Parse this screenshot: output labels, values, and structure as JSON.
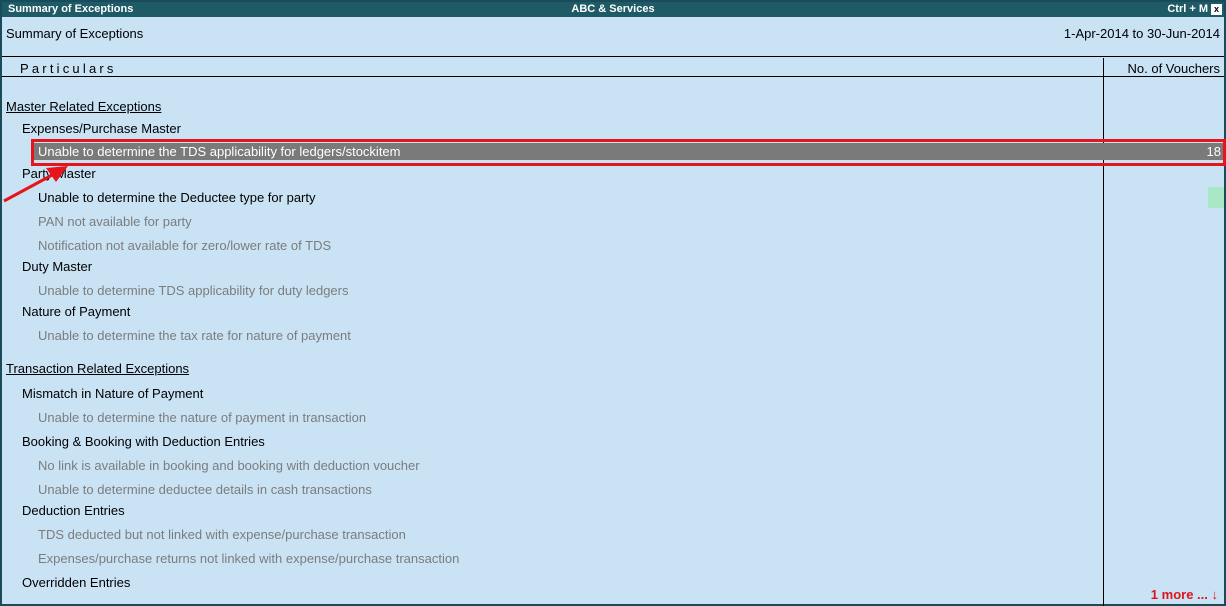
{
  "titlebar": {
    "left": "Summary of Exceptions",
    "center": "ABC & Services",
    "shortcut": "Ctrl + M",
    "close": "x"
  },
  "header": {
    "title": "Summary of Exceptions",
    "period": "1-Apr-2014 to 30-Jun-2014"
  },
  "columns": {
    "particulars": "Particulars",
    "vouchers": "No. of Vouchers"
  },
  "master": {
    "title": "Master Related Exceptions",
    "expenses_group": "Expenses/Purchase Master",
    "expenses_item": "Unable to determine the TDS applicability for ledgers/stockitem",
    "expenses_count": "18",
    "party_group": "Party Master",
    "party_items": [
      "Unable to determine the Deductee type for party",
      "PAN not available for party",
      "Notification not available for zero/lower rate of TDS"
    ],
    "duty_group": "Duty Master",
    "duty_item": "Unable to determine TDS applicability for duty ledgers",
    "nop_group": "Nature of Payment",
    "nop_item": "Unable to determine the tax rate for nature of payment"
  },
  "transaction": {
    "title": "Transaction Related Exceptions",
    "mismatch_group": "Mismatch in Nature of Payment",
    "mismatch_item": "Unable to determine the nature of payment in transaction",
    "booking_group": "Booking & Booking with Deduction Entries",
    "booking_items": [
      "No link is available in booking and booking with deduction voucher",
      "Unable to determine deductee details in cash transactions"
    ],
    "deduction_group": "Deduction Entries",
    "deduction_items": [
      "TDS deducted but not linked with expense/purchase transaction",
      "Expenses/purchase returns not linked with expense/purchase transaction"
    ],
    "overridden_group": "Overridden Entries"
  },
  "footer": {
    "more": "1 more ... ↓"
  },
  "colors": {
    "background": "#c9e3f5",
    "titlebar": "#1f5b66",
    "selection": "#7a7a7a",
    "highlight_box": "#e8141c",
    "dim_text": "#7c7c7c"
  }
}
